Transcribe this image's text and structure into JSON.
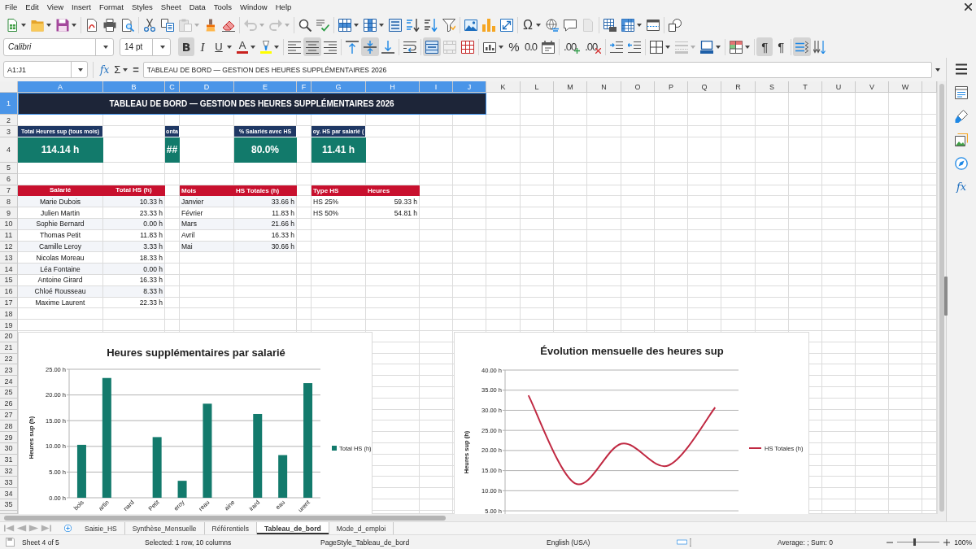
{
  "menu_bar": [
    "File",
    "Edit",
    "View",
    "Insert",
    "Format",
    "Styles",
    "Sheet",
    "Data",
    "Tools",
    "Window",
    "Help"
  ],
  "standard_toolbar": [
    {
      "kind": "new",
      "disabled": false
    },
    {
      "kind": "open",
      "disabled": false
    },
    {
      "kind": "save",
      "disabled": false
    },
    {
      "kind": "pdf",
      "disabled": false
    },
    {
      "kind": "print",
      "disabled": false
    },
    {
      "kind": "preview",
      "disabled": false
    },
    {
      "kind": "cut",
      "disabled": false
    },
    {
      "kind": "copy",
      "disabled": false
    },
    {
      "kind": "paste",
      "disabled": true
    },
    {
      "kind": "clone",
      "disabled": false
    },
    {
      "kind": "clearformat",
      "disabled": false
    },
    {
      "kind": "undo",
      "disabled": true
    },
    {
      "kind": "redo",
      "disabled": true
    },
    {
      "kind": "find",
      "disabled": false
    },
    {
      "kind": "spelling",
      "disabled": false
    },
    {
      "kind": "rows",
      "disabled": false
    },
    {
      "kind": "columns",
      "disabled": false
    },
    {
      "kind": "sort",
      "disabled": false
    },
    {
      "kind": "sortasc",
      "disabled": false
    },
    {
      "kind": "sortdesc",
      "disabled": false
    },
    {
      "kind": "autofilter",
      "disabled": false
    },
    {
      "kind": "image",
      "disabled": false
    },
    {
      "kind": "chart",
      "disabled": false
    },
    {
      "kind": "pivot",
      "disabled": false
    },
    {
      "kind": "specialchar",
      "glyph": "Ω",
      "disabled": false
    },
    {
      "kind": "hyperlink",
      "disabled": false
    },
    {
      "kind": "comment",
      "disabled": false
    },
    {
      "kind": "headerfooter",
      "disabled": true
    },
    {
      "kind": "printarea",
      "disabled": false
    },
    {
      "kind": "freeze",
      "disabled": false
    },
    {
      "kind": "split",
      "disabled": false
    },
    {
      "kind": "draw",
      "disabled": false
    }
  ],
  "formatting_toolbar": {
    "font_name": "Calibri",
    "font_size": "14 pt",
    "buttons": [
      {
        "kind": "bold",
        "glyph": "B",
        "on": true,
        "disabled": false
      },
      {
        "kind": "italic",
        "glyph": "I",
        "on": false,
        "disabled": false
      },
      {
        "kind": "underline",
        "glyph": "U",
        "on": false,
        "disabled": false
      },
      {
        "kind": "fontcolor",
        "glyph": "A",
        "color": "#c9211e",
        "on": false,
        "disabled": false
      },
      {
        "kind": "highlight",
        "color": "#ffff00",
        "on": false,
        "disabled": false
      },
      {
        "kind": "alignleft",
        "on": false,
        "disabled": false
      },
      {
        "kind": "aligncenter",
        "on": true,
        "disabled": false
      },
      {
        "kind": "alignright",
        "on": false,
        "disabled": false
      },
      {
        "kind": "aligntop",
        "on": false,
        "disabled": false
      },
      {
        "kind": "alignmiddle",
        "on": true,
        "disabled": false
      },
      {
        "kind": "alignbottom",
        "on": false,
        "disabled": false
      },
      {
        "kind": "wrap",
        "on": false,
        "disabled": false
      },
      {
        "kind": "mergecenter",
        "on": true,
        "disabled": false
      },
      {
        "kind": "merge",
        "on": false,
        "disabled": true
      },
      {
        "kind": "unmerge",
        "on": false,
        "disabled": false
      },
      {
        "kind": "numberformat",
        "on": false,
        "disabled": false
      },
      {
        "kind": "percent",
        "glyph": "%",
        "on": false,
        "disabled": false
      },
      {
        "kind": "standardformat",
        "glyph": "0.0",
        "on": false,
        "disabled": false
      },
      {
        "kind": "date",
        "on": false,
        "disabled": false
      },
      {
        "kind": "adddecimal",
        "glyph": ".00",
        "on": false,
        "disabled": false
      },
      {
        "kind": "deletedecimal",
        "glyph": ".00",
        "on": false,
        "disabled": false
      },
      {
        "kind": "indent",
        "on": false,
        "disabled": false
      },
      {
        "kind": "outdent",
        "on": false,
        "disabled": false
      },
      {
        "kind": "borders",
        "on": false,
        "disabled": false
      },
      {
        "kind": "borderstyle",
        "on": false,
        "disabled": true
      },
      {
        "kind": "bordercolor",
        "on": false,
        "disabled": false
      },
      {
        "kind": "conditional",
        "on": false,
        "disabled": false
      },
      {
        "kind": "ltr",
        "glyph": "¶",
        "on": true,
        "disabled": false
      },
      {
        "kind": "rtl",
        "glyph": "¶",
        "on": false,
        "disabled": false
      },
      {
        "kind": "horizontal",
        "on": true,
        "disabled": false
      },
      {
        "kind": "vertical",
        "on": false,
        "disabled": false
      }
    ]
  },
  "formula_bar": {
    "name_box": "A1:J1",
    "function_wizard": "fx",
    "sum": "Σ",
    "equals": "=",
    "content": "TABLEAU DE BORD — GESTION DES HEURES SUPPLÉMENTAIRES 2026"
  },
  "sheet": {
    "columns": [
      {
        "label": "A",
        "selected": true
      },
      {
        "label": "B",
        "selected": true
      },
      {
        "label": "C",
        "selected": true
      },
      {
        "label": "D",
        "selected": true
      },
      {
        "label": "E",
        "selected": true
      },
      {
        "label": "F",
        "selected": true
      },
      {
        "label": "G",
        "selected": true
      },
      {
        "label": "H",
        "selected": true
      },
      {
        "label": "I",
        "selected": true
      },
      {
        "label": "J",
        "selected": true
      },
      {
        "label": "K",
        "selected": false
      },
      {
        "label": "L",
        "selected": false
      },
      {
        "label": "M",
        "selected": false
      },
      {
        "label": "N",
        "selected": false
      },
      {
        "label": "O",
        "selected": false
      },
      {
        "label": "P",
        "selected": false
      },
      {
        "label": "Q",
        "selected": false
      },
      {
        "label": "R",
        "selected": false
      },
      {
        "label": "S",
        "selected": false
      },
      {
        "label": "T",
        "selected": false
      },
      {
        "label": "U",
        "selected": false
      },
      {
        "label": "V",
        "selected": false
      },
      {
        "label": "W",
        "selected": false
      }
    ],
    "rows": [
      {
        "label": "1",
        "selected": true
      },
      {
        "label": "2",
        "selected": false
      },
      {
        "label": "3",
        "selected": false
      },
      {
        "label": "4",
        "selected": false
      },
      {
        "label": "5",
        "selected": false
      },
      {
        "label": "6",
        "selected": false
      },
      {
        "label": "7",
        "selected": false
      },
      {
        "label": "8",
        "selected": false
      },
      {
        "label": "9",
        "selected": false
      },
      {
        "label": "10",
        "selected": false
      },
      {
        "label": "11",
        "selected": false
      },
      {
        "label": "12",
        "selected": false
      },
      {
        "label": "13",
        "selected": false
      },
      {
        "label": "14",
        "selected": false
      },
      {
        "label": "15",
        "selected": false
      },
      {
        "label": "16",
        "selected": false
      },
      {
        "label": "17",
        "selected": false
      },
      {
        "label": "18",
        "selected": false
      },
      {
        "label": "19",
        "selected": false
      },
      {
        "label": "20",
        "selected": false
      },
      {
        "label": "21",
        "selected": false
      },
      {
        "label": "22",
        "selected": false
      },
      {
        "label": "23",
        "selected": false
      },
      {
        "label": "24",
        "selected": false
      },
      {
        "label": "25",
        "selected": false
      },
      {
        "label": "26",
        "selected": false
      },
      {
        "label": "27",
        "selected": false
      },
      {
        "label": "28",
        "selected": false
      },
      {
        "label": "29",
        "selected": false
      },
      {
        "label": "30",
        "selected": false
      },
      {
        "label": "31",
        "selected": false
      },
      {
        "label": "32",
        "selected": false
      },
      {
        "label": "33",
        "selected": false
      },
      {
        "label": "34",
        "selected": false
      },
      {
        "label": "35",
        "selected": false
      }
    ],
    "title": {
      "text": "TABLEAU DE BORD — GESTION DES HEURES SUPPLÉMENTAIRES 2026",
      "selected": true
    },
    "kpis": [
      {
        "label": "Total Heures sup (tous mois)",
        "value": "114.14 h"
      },
      {
        "label": "onta",
        "value": "##"
      },
      {
        "label": "% Salariés avec HS",
        "value": "80.0%"
      },
      {
        "label": "oy. HS par salarié (",
        "value": "11.41 h"
      }
    ],
    "tables": [
      {
        "columns": [
          "Salarié",
          "Total HS (h)"
        ],
        "rows": [
          [
            "Marie Dubois",
            "10.33 h"
          ],
          [
            "Julien Martin",
            "23.33 h"
          ],
          [
            "Sophie Bernard",
            "0.00 h"
          ],
          [
            "Thomas Petit",
            "11.83 h"
          ],
          [
            "Camille Leroy",
            "3.33 h"
          ],
          [
            "Nicolas Moreau",
            "18.33 h"
          ],
          [
            "Léa Fontaine",
            "0.00 h"
          ],
          [
            "Antoine Girard",
            "16.33 h"
          ],
          [
            "Chloé Rousseau",
            "8.33 h"
          ],
          [
            "Maxime Laurent",
            "22.33 h"
          ]
        ]
      },
      {
        "columns": [
          "Mois",
          "HS Totales (h)"
        ],
        "rows": [
          [
            "Janvier",
            "33.66 h"
          ],
          [
            "Février",
            "11.83 h"
          ],
          [
            "Mars",
            "21.66 h"
          ],
          [
            "Avril",
            "16.33 h"
          ],
          [
            "Mai",
            "30.66 h"
          ]
        ]
      },
      {
        "columns": [
          "Type HS",
          "Heures"
        ],
        "rows": [
          [
            "HS 25%",
            "59.33 h"
          ],
          [
            "HS 50%",
            "54.81 h"
          ]
        ]
      }
    ],
    "charts": [
      {
        "chart_data": {
          "type": "bar",
          "title": "Heures supplémentaires par salarié",
          "ylabel": "Heures sup (h)",
          "categories": [
            "bois",
            "artin",
            "nard",
            "Petit",
            "eroy",
            "reau",
            "aine",
            "irard",
            "eau",
            "urent"
          ],
          "series": [
            {
              "name": "Total HS (h)",
              "color": "#137a6c",
              "values": [
                10.3,
                23.3,
                0,
                11.8,
                3.3,
                18.3,
                0,
                16.3,
                8.3,
                22.3
              ]
            }
          ],
          "ylim": [
            0,
            25
          ],
          "grid": true,
          "yticks": [
            {
              "value": 0,
              "label": "0.00 h"
            },
            {
              "value": 5,
              "label": "5.00 h"
            },
            {
              "value": 10,
              "label": "10.00 h"
            },
            {
              "value": 15,
              "label": "15.00 h"
            },
            {
              "value": 20,
              "label": "20.00 h"
            },
            {
              "value": 25,
              "label": "25.00 h"
            }
          ]
        }
      },
      {
        "chart_data": {
          "type": "line",
          "title": "Évolution mensuelle des heures sup",
          "ylabel": "Heures sup (h)",
          "series": [
            {
              "name": "HS Totales (h)",
              "color": "#c02942",
              "values": [
                33.7,
                11.8,
                21.7,
                16.3,
                30.7
              ]
            }
          ],
          "ylim": [
            4,
            40
          ],
          "grid": true,
          "yticks": [
            {
              "value": 5,
              "label": "5.00 h"
            },
            {
              "value": 10,
              "label": "10.00 h"
            },
            {
              "value": 15,
              "label": "15.00 h"
            },
            {
              "value": 20,
              "label": "20.00 h"
            },
            {
              "value": 25,
              "label": "25.00 h"
            },
            {
              "value": 30,
              "label": "30.00 h"
            },
            {
              "value": 35,
              "label": "35.00 h"
            },
            {
              "value": 40,
              "label": "40.00 h"
            }
          ]
        }
      }
    ]
  },
  "sidebar": {
    "functions": "fx"
  },
  "sheet_tabs": [
    {
      "label": "Saisie_HS",
      "selected": false
    },
    {
      "label": "Synthèse_Mensuelle",
      "selected": false
    },
    {
      "label": "Référentiels",
      "selected": false
    },
    {
      "label": "Tableau_de_bord",
      "selected": true
    },
    {
      "label": "Mode_d_emploi",
      "selected": false
    }
  ],
  "status_bar": {
    "sheet": "Sheet 4 of 5",
    "selection": "Selected: 1 row, 10 columns",
    "page_style": "PageStyle_Tableau_de_bord",
    "language": "English (USA)",
    "summary": "Average: ; Sum: 0",
    "zoom": {
      "level": 0.4,
      "value": "100%"
    }
  }
}
